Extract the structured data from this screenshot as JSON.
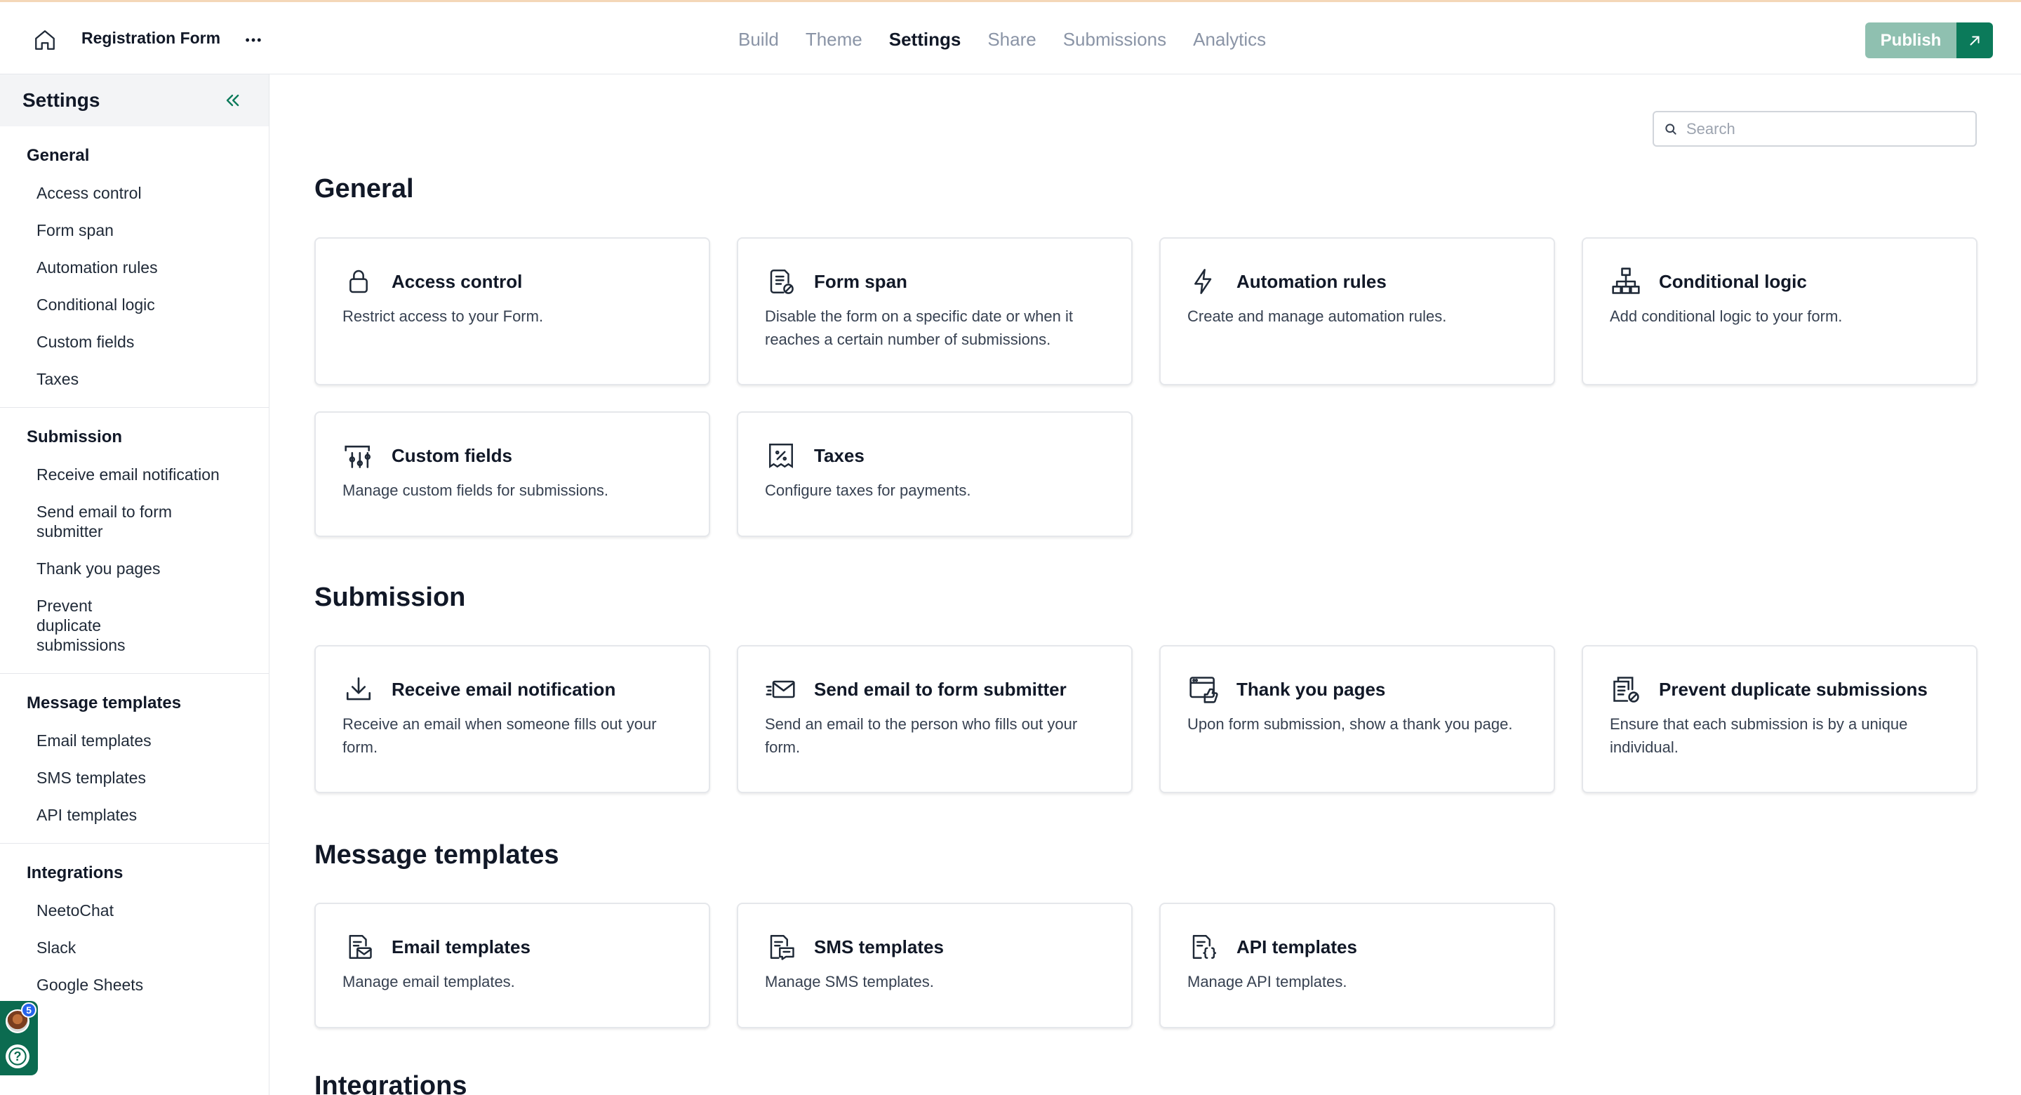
{
  "header": {
    "form_title": "Registration Form",
    "more_label": "•••",
    "tabs": [
      {
        "label": "Build"
      },
      {
        "label": "Theme"
      },
      {
        "label": "Settings",
        "active": true
      },
      {
        "label": "Share"
      },
      {
        "label": "Submissions"
      },
      {
        "label": "Analytics"
      }
    ],
    "publish_label": "Publish"
  },
  "sidebar": {
    "title": "Settings",
    "sections": [
      {
        "heading": "General",
        "items": [
          "Access control",
          "Form span",
          "Automation rules",
          "Conditional logic",
          "Custom fields",
          "Taxes"
        ]
      },
      {
        "heading": "Submission",
        "items": [
          "Receive email notification",
          "Send email to form submitter",
          "Thank you pages",
          "Prevent duplicate submissions"
        ]
      },
      {
        "heading": "Message templates",
        "items": [
          "Email templates",
          "SMS templates",
          "API templates"
        ]
      },
      {
        "heading": "Integrations",
        "items": [
          "NeetoChat",
          "Slack",
          "Google Sheets"
        ]
      }
    ]
  },
  "help_dock": {
    "notification_count": "5",
    "help_symbol": "?"
  },
  "search": {
    "placeholder": "Search",
    "value": ""
  },
  "main": {
    "sections": [
      {
        "title": "General",
        "cards": [
          {
            "icon": "lock-icon",
            "title": "Access control",
            "description": "Restrict access to your Form."
          },
          {
            "icon": "form-span-icon",
            "title": "Form span",
            "description": "Disable the form on a specific date or when it reaches a certain number of submissions."
          },
          {
            "icon": "lightning-icon",
            "title": "Automation rules",
            "description": "Create and manage automation rules."
          },
          {
            "icon": "flowchart-icon",
            "title": "Conditional logic",
            "description": "Add conditional logic to your form."
          },
          {
            "icon": "sliders-icon",
            "title": "Custom fields",
            "description": "Manage custom fields for submissions."
          },
          {
            "icon": "percent-receipt-icon",
            "title": "Taxes",
            "description": "Configure taxes for payments."
          }
        ]
      },
      {
        "title": "Submission",
        "cards": [
          {
            "icon": "inbox-download-icon",
            "title": "Receive email notification",
            "description": "Receive an email when someone fills out your form."
          },
          {
            "icon": "send-mail-icon",
            "title": "Send email to form submitter",
            "description": "Send an email to the person who fills out your form."
          },
          {
            "icon": "thank-you-page-icon",
            "title": "Thank you pages",
            "description": "Upon form submission, show a thank you page."
          },
          {
            "icon": "duplicate-block-icon",
            "title": "Prevent duplicate submissions",
            "description": "Ensure that each submission is by a unique individual."
          }
        ]
      },
      {
        "title": "Message templates",
        "cards": [
          {
            "icon": "email-template-icon",
            "title": "Email templates",
            "description": "Manage email templates."
          },
          {
            "icon": "sms-template-icon",
            "title": "SMS templates",
            "description": "Manage SMS templates."
          },
          {
            "icon": "api-template-icon",
            "title": "API templates",
            "description": "Manage API templates."
          }
        ]
      },
      {
        "title": "Integrations",
        "cards": []
      }
    ]
  }
}
